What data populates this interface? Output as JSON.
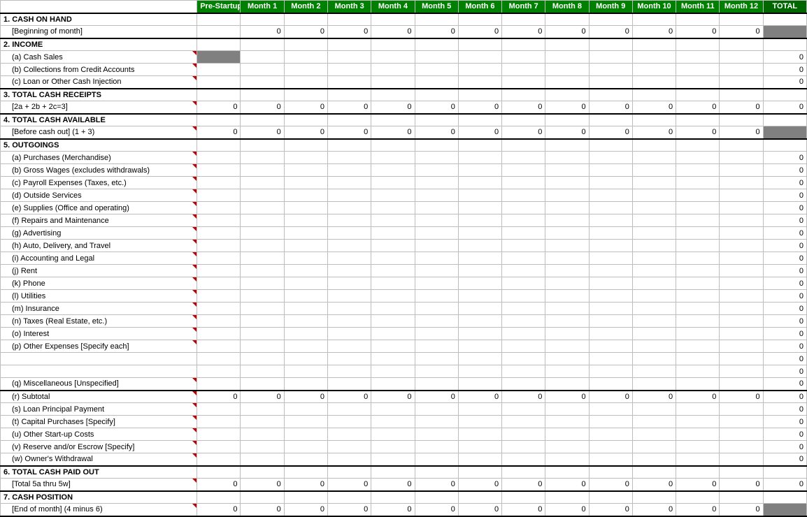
{
  "headers": {
    "label": "",
    "pre": "Pre-Startup",
    "m1": "Month 1",
    "m2": "Month 2",
    "m3": "Month 3",
    "m4": "Month 4",
    "m5": "Month 5",
    "m6": "Month 6",
    "m7": "Month 7",
    "m8": "Month 8",
    "m9": "Month 9",
    "m10": "Month 10",
    "m11": "Month 11",
    "m12": "Month 12",
    "total": "TOTAL"
  },
  "rows": {
    "r0": {
      "label": "1. CASH ON HAND"
    },
    "r1": {
      "label": "[Beginning of month]",
      "pre": "",
      "m1": "0",
      "m2": "0",
      "m3": "0",
      "m4": "0",
      "m5": "0",
      "m6": "0",
      "m7": "0",
      "m8": "0",
      "m9": "0",
      "m10": "0",
      "m11": "0",
      "m12": "0",
      "total": ""
    },
    "r2": {
      "label": "2. INCOME"
    },
    "r3": {
      "label": "(a) Cash Sales",
      "total": "0"
    },
    "r4": {
      "label": "(b) Collections from Credit Accounts",
      "total": "0"
    },
    "r5": {
      "label": "(c) Loan or Other Cash Injection",
      "total": "0"
    },
    "r6": {
      "label": "3. TOTAL CASH RECEIPTS"
    },
    "r7": {
      "label": "[2a + 2b + 2c=3]",
      "pre": "0",
      "m1": "0",
      "m2": "0",
      "m3": "0",
      "m4": "0",
      "m5": "0",
      "m6": "0",
      "m7": "0",
      "m8": "0",
      "m9": "0",
      "m10": "0",
      "m11": "0",
      "m12": "0",
      "total": "0"
    },
    "r8": {
      "label": "4. TOTAL CASH AVAILABLE"
    },
    "r9": {
      "label": "[Before cash out] (1 + 3)",
      "pre": "0",
      "m1": "0",
      "m2": "0",
      "m3": "0",
      "m4": "0",
      "m5": "0",
      "m6": "0",
      "m7": "0",
      "m8": "0",
      "m9": "0",
      "m10": "0",
      "m11": "0",
      "m12": "0",
      "total": ""
    },
    "r10": {
      "label": "5. OUTGOINGS"
    },
    "r11": {
      "label": "(a) Purchases (Merchandise)",
      "total": "0"
    },
    "r12": {
      "label": "(b) Gross Wages (excludes withdrawals)",
      "total": "0"
    },
    "r13": {
      "label": "(c) Payroll Expenses (Taxes, etc.)",
      "total": "0"
    },
    "r14": {
      "label": "(d) Outside Services",
      "total": "0"
    },
    "r15": {
      "label": "(e) Supplies (Office and operating)",
      "total": "0"
    },
    "r16": {
      "label": "(f) Repairs and Maintenance",
      "total": "0"
    },
    "r17": {
      "label": "(g) Advertising",
      "total": "0"
    },
    "r18": {
      "label": "(h) Auto, Delivery, and Travel",
      "total": "0"
    },
    "r19": {
      "label": "(i) Accounting and Legal",
      "total": "0"
    },
    "r20": {
      "label": "(j) Rent",
      "total": "0"
    },
    "r21": {
      "label": "(k) Phone",
      "total": "0"
    },
    "r22": {
      "label": "(l) Utilities",
      "total": "0"
    },
    "r23": {
      "label": "(m) Insurance",
      "total": "0"
    },
    "r24": {
      "label": "(n) Taxes (Real Estate, etc.)",
      "total": "0"
    },
    "r25": {
      "label": "(o) Interest",
      "total": "0"
    },
    "r26": {
      "label": "(p) Other Expenses [Specify each]",
      "total": "0"
    },
    "r27": {
      "label": "",
      "total": "0"
    },
    "r28": {
      "label": "",
      "total": "0"
    },
    "r29": {
      "label": "(q) Miscellaneous [Unspecified]",
      "total": "0"
    },
    "r30": {
      "label": "(r) Subtotal",
      "pre": "0",
      "m1": "0",
      "m2": "0",
      "m3": "0",
      "m4": "0",
      "m5": "0",
      "m6": "0",
      "m7": "0",
      "m8": "0",
      "m9": "0",
      "m10": "0",
      "m11": "0",
      "m12": "0",
      "total": "0"
    },
    "r31": {
      "label": "(s) Loan Principal Payment",
      "total": "0"
    },
    "r32": {
      "label": "(t) Capital Purchases [Specify]",
      "total": "0"
    },
    "r33": {
      "label": "(u) Other Start-up Costs",
      "total": "0"
    },
    "r34": {
      "label": "(v) Reserve and/or Escrow [Specify]",
      "total": "0"
    },
    "r35": {
      "label": "(w) Owner's Withdrawal",
      "total": "0"
    },
    "r36": {
      "label": "6. TOTAL CASH PAID OUT"
    },
    "r37": {
      "label": "[Total 5a thru 5w]",
      "pre": "0",
      "m1": "0",
      "m2": "0",
      "m3": "0",
      "m4": "0",
      "m5": "0",
      "m6": "0",
      "m7": "0",
      "m8": "0",
      "m9": "0",
      "m10": "0",
      "m11": "0",
      "m12": "0",
      "total": "0"
    },
    "r38": {
      "label": "7. CASH POSITION"
    },
    "r39": {
      "label": "[End of month]  (4 minus 6)",
      "pre": "0",
      "m1": "0",
      "m2": "0",
      "m3": "0",
      "m4": "0",
      "m5": "0",
      "m6": "0",
      "m7": "0",
      "m8": "0",
      "m9": "0",
      "m10": "0",
      "m11": "0",
      "m12": "0",
      "total": ""
    }
  }
}
